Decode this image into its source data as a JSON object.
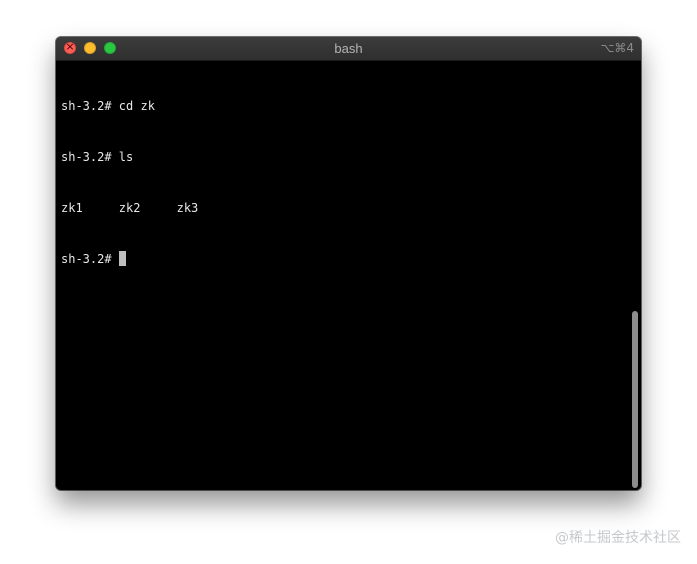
{
  "window": {
    "title": "bash",
    "shortcut": "⌥⌘4"
  },
  "terminal": {
    "lines": [
      "sh-3.2# cd zk",
      "sh-3.2# ls",
      "zk1     zk2     zk3",
      "sh-3.2#"
    ]
  },
  "watermark": {
    "text": "@稀土掘金技术社区"
  }
}
